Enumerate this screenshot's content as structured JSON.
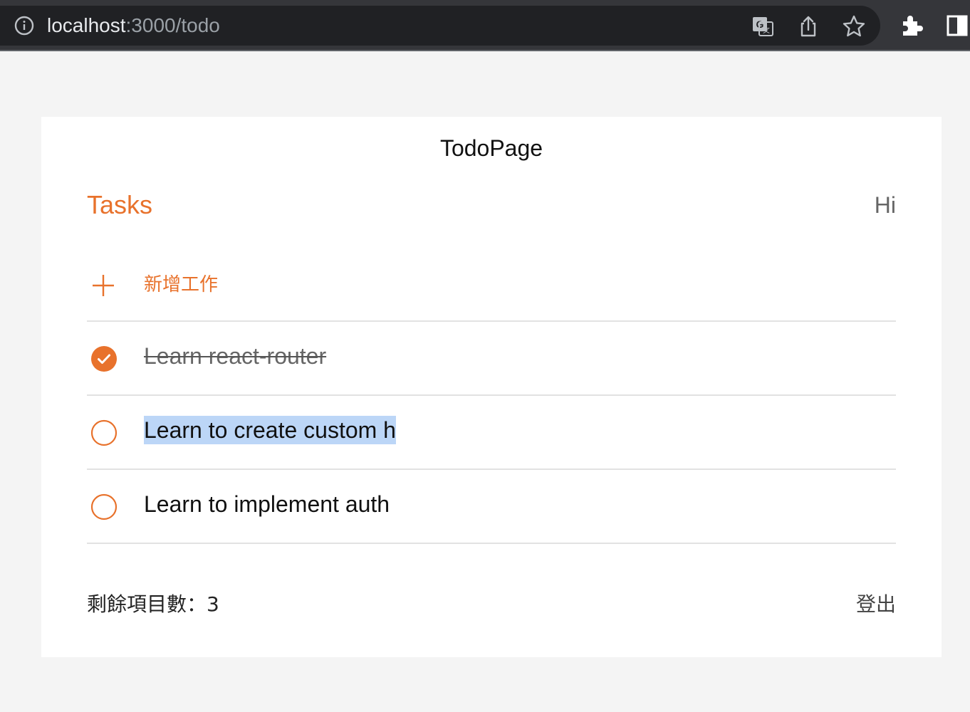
{
  "browser": {
    "url_host": "localhost",
    "url_path": ":3000/todo",
    "icons": [
      "info-icon",
      "translate-icon",
      "share-icon",
      "star-icon",
      "extensions-icon",
      "side-panel-icon"
    ]
  },
  "page": {
    "title": "TodoPage",
    "heading": "Tasks",
    "greeting": "Hi"
  },
  "add_task": {
    "label": "新增工作",
    "icon": "plus-icon"
  },
  "tasks": [
    {
      "text": "Learn react-router",
      "done": true
    },
    {
      "text": "Learn to create custom h",
      "done": false,
      "selected": true
    },
    {
      "text": "Learn to implement auth",
      "done": false
    }
  ],
  "footer": {
    "remaining_label": "剩餘項目數：3",
    "logout_label": "登出"
  },
  "colors": {
    "accent": "#e8722c",
    "selection": "#bcd6f7",
    "chrome_bg": "#35363a"
  }
}
